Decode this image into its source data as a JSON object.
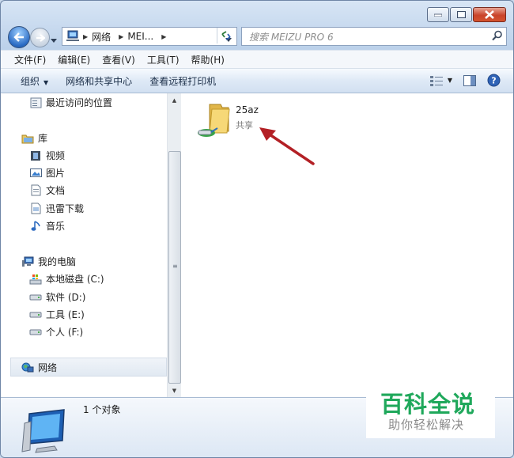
{
  "address_bar": {
    "segments": [
      "网络",
      "MEI..."
    ]
  },
  "search": {
    "placeholder": "搜索 MEIZU PRO 6"
  },
  "menu": [
    "文件(F)",
    "编辑(E)",
    "查看(V)",
    "工具(T)",
    "帮助(H)"
  ],
  "commands": {
    "organize": "组织",
    "network_center": "网络和共享中心",
    "remote_printer": "查看远程打印机"
  },
  "nav": {
    "recent": "最近访问的位置",
    "library": "库",
    "videos": "视频",
    "pictures": "图片",
    "documents": "文档",
    "xunlei": "迅雷下载",
    "music": "音乐",
    "computer": "我的电脑",
    "drive_c": "本地磁盘 (C:)",
    "drive_d": "软件 (D:)",
    "drive_e": "工具 (E:)",
    "drive_f": "个人 (F:)",
    "network": "网络"
  },
  "content": {
    "folder_name": "25az",
    "folder_sub": "共享"
  },
  "details": {
    "count": "1 个对象"
  },
  "watermark": {
    "title": "百科全说",
    "subtitle": "助你轻松解决"
  },
  "colors": {
    "accent_arrow": "#b32025",
    "watermark_green": "#1fa85b"
  }
}
